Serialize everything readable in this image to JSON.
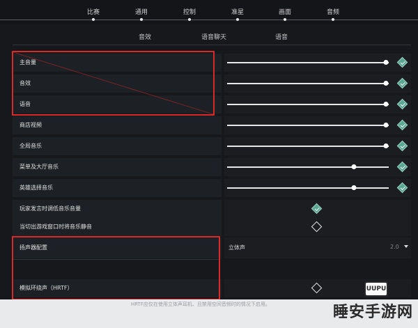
{
  "top_nav": {
    "items": [
      {
        "label": "比赛"
      },
      {
        "label": "通用"
      },
      {
        "label": "控制"
      },
      {
        "label": "准星"
      },
      {
        "label": "画面"
      },
      {
        "label": "音频"
      }
    ]
  },
  "sub_tabs": [
    {
      "label": "音效"
    },
    {
      "label": "语音聊天"
    },
    {
      "label": "语音"
    }
  ],
  "volume_rows": [
    {
      "label": "主音量",
      "level": 0.98,
      "checked": true
    },
    {
      "label": "音效",
      "level": 0.98,
      "checked": true
    },
    {
      "label": "语音",
      "level": 0.98,
      "checked": true
    },
    {
      "label": "商店视频",
      "level": 0.98,
      "checked": true
    },
    {
      "label": "全局音乐",
      "level": 0.98,
      "checked": true
    },
    {
      "label": "菜单及大厅音乐",
      "level": 0.78,
      "checked": true
    },
    {
      "label": "英雄选择音乐",
      "level": 0.78,
      "checked": true
    }
  ],
  "toggle_rows": [
    {
      "label": "玩家发言时调低音乐音量",
      "checked": true
    },
    {
      "label": "当切出游戏窗口时将音乐静音",
      "checked": false
    }
  ],
  "speaker_config": {
    "label": "扬声器配置",
    "value": "立体声",
    "secondary": "2.0"
  },
  "hrtf": {
    "label": "模拟环绕声（HRTF）",
    "checked": false
  },
  "footer_note": "HRTF应仅在使用立体声耳机、且禁用空间音频时的情况下启用。",
  "watermark": {
    "text": "睡安手游网",
    "logo": "UUPU"
  },
  "colors": {
    "accent_check": "#5aa794",
    "highlight_box": "#d92a2a"
  }
}
